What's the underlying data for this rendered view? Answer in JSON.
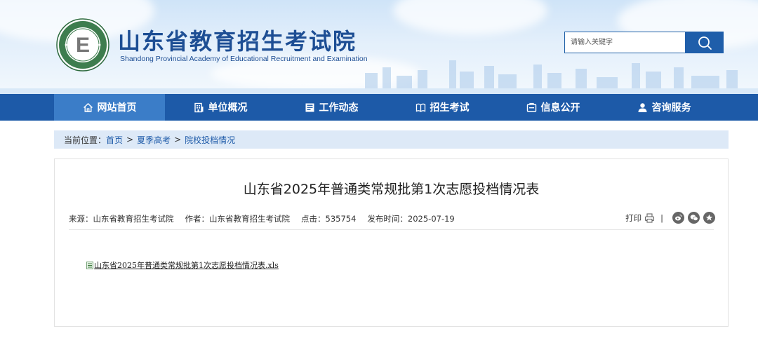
{
  "header": {
    "title_cn": "山东省教育招生考试院",
    "title_en": "Shandong Provincial Academy of Educational Recruitment and Examination",
    "search_placeholder": "请输入关键字",
    "logo_letter": "E",
    "logo_ring_text_top": "Shandong Educational Admission & Examination",
    "logo_ring_text_bottom": "山东省教育招生考试院"
  },
  "nav": {
    "items": [
      {
        "label": "网站首页",
        "icon": "home-icon"
      },
      {
        "label": "单位概况",
        "icon": "building-icon"
      },
      {
        "label": "工作动态",
        "icon": "news-icon"
      },
      {
        "label": "招生考试",
        "icon": "book-icon"
      },
      {
        "label": "信息公开",
        "icon": "info-icon"
      },
      {
        "label": "咨询服务",
        "icon": "user-icon"
      }
    ]
  },
  "breadcrumb": {
    "prefix": "当前位置：",
    "items": [
      "首页",
      "夏季高考",
      "院校投档情况"
    ],
    "separator": ">"
  },
  "article": {
    "title": "山东省2025年普通类常规批第1次志愿投档情况表",
    "source": "来源：山东省教育招生考试院",
    "author": "作者：山东省教育招生考试院",
    "clicks": "点击：535754",
    "date": "发布时间：2025-07-19",
    "print_label": "打印",
    "tools_separator": "|",
    "share_icons": [
      "weibo-icon",
      "wechat-icon",
      "favorite-icon"
    ],
    "attachment": "山东省2025年普通类常规批第1次志愿投档情况表.xls"
  },
  "colors": {
    "nav_bg": "#1d5aa8",
    "nav_active": "#3b7dc8",
    "brand_blue": "#1d4e94",
    "breadcrumb_bg": "#dde9f7"
  }
}
